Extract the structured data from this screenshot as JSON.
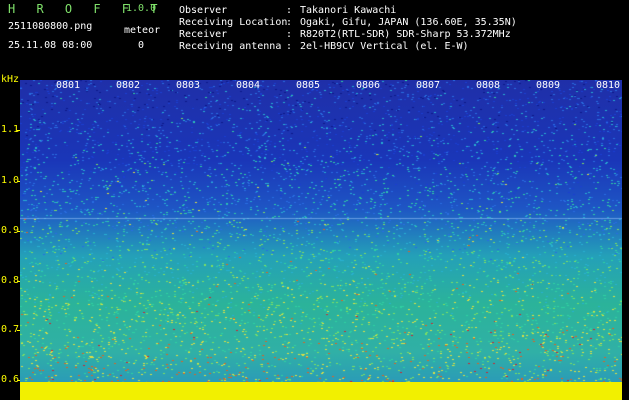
{
  "header": {
    "app_name": "H R O F F T",
    "version": "1.0.0",
    "file_name": "2511080800.png",
    "datetime": "25.11.08 08:00",
    "meteor_label": "meteor",
    "meteor_count": "0",
    "info": [
      {
        "key": "Observer",
        "value": "Takanori Kawachi"
      },
      {
        "key": "Receiving Location",
        "value": "Ogaki, Gifu, JAPAN (136.60E, 35.35N)"
      },
      {
        "key": "Receiver",
        "value": "R820T2(RTL-SDR) SDR-Sharp 53.372MHz"
      },
      {
        "key": "Receiving antenna",
        "value": "2el-HB9CV Vertical (el. E-W)"
      }
    ]
  },
  "spectrogram": {
    "y_unit": "kHz",
    "y_ticks": [
      "1.1",
      "1.0",
      "0.9",
      "0.8",
      "0.7",
      "0.6"
    ],
    "x_ticks": [
      "0801",
      "0802",
      "0803",
      "0804",
      "0805",
      "0806",
      "0807",
      "0808",
      "0809",
      "0810"
    ],
    "colors": {
      "low": "#1f2fa8",
      "mid": "#2bb39a",
      "high": "#e03030",
      "floor": "#f2f000"
    }
  }
}
